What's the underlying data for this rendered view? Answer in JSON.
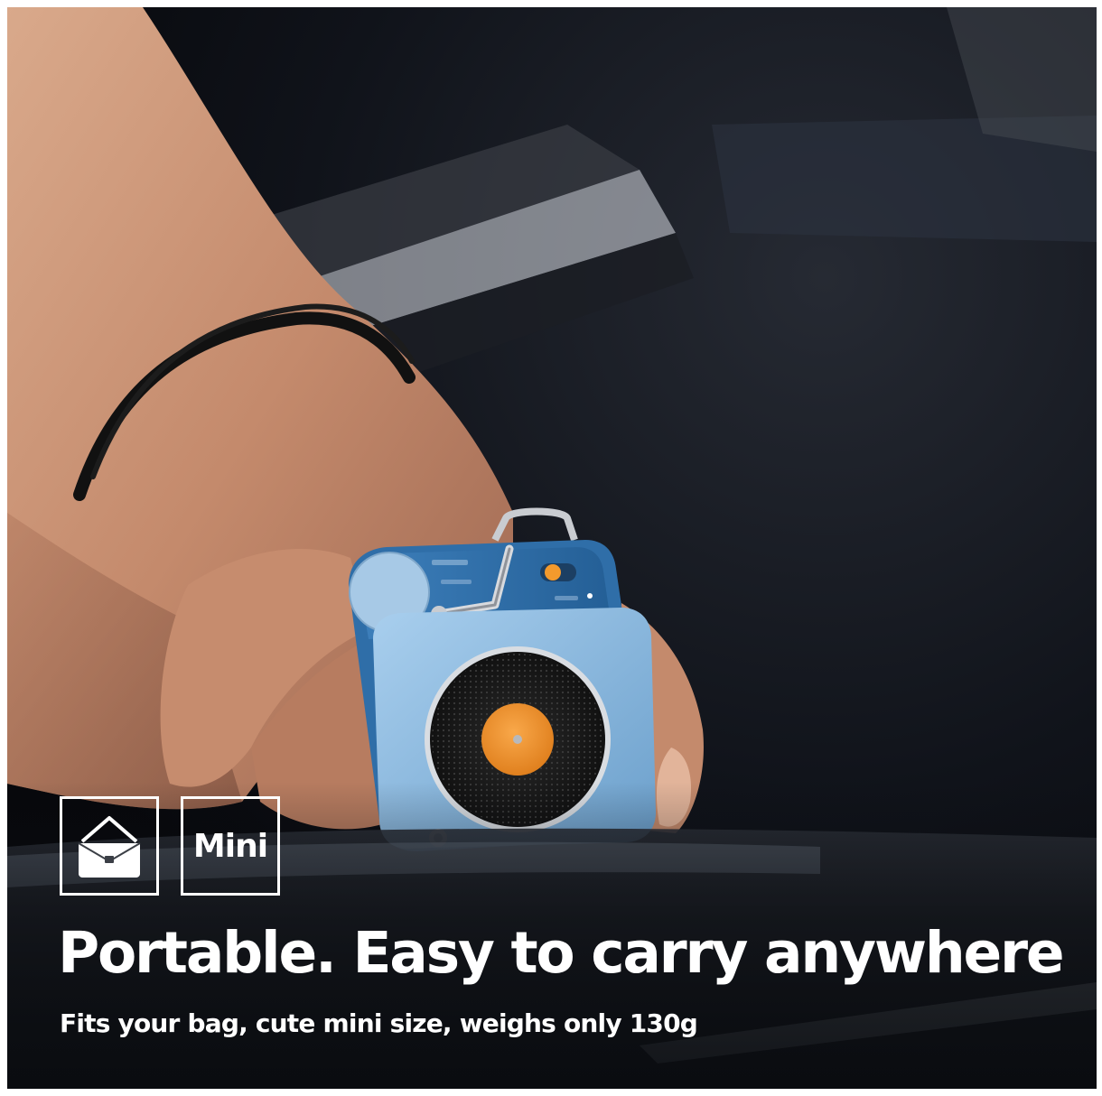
{
  "badges": {
    "bag_icon": "briefcase-icon",
    "size_label": "Mini"
  },
  "headline": "Portable. Easy to carry anywhere",
  "subline": "Fits your bag, cute mini size, weighs only 130g",
  "colors": {
    "speaker_body": "#7fb2db",
    "speaker_back": "#2f6ea8",
    "record_label": "#f0952a",
    "text": "#ffffff"
  }
}
